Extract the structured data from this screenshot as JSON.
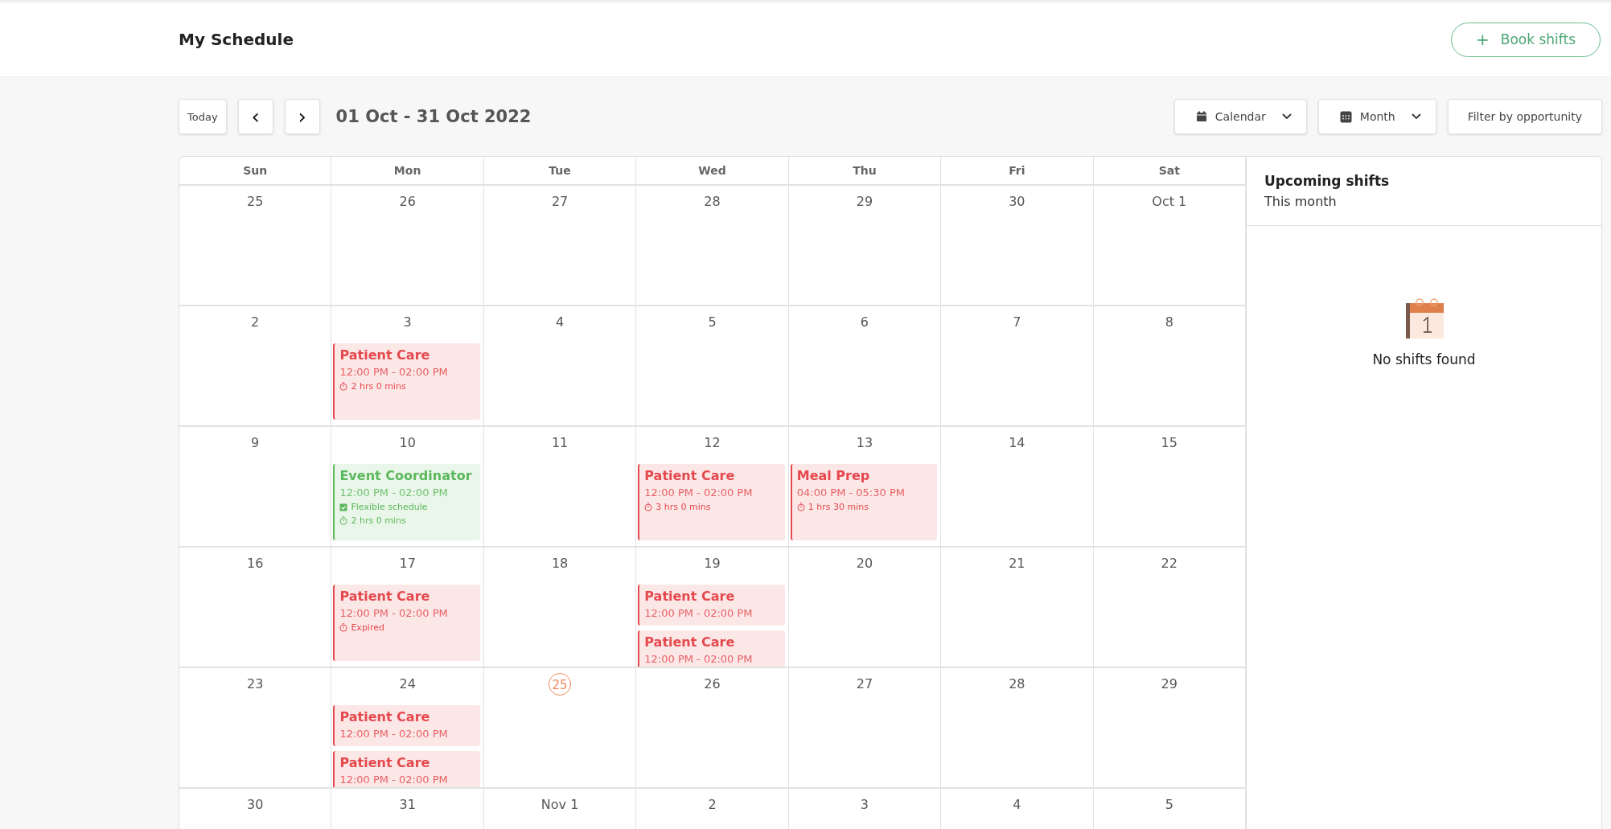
{
  "header": {
    "title": "My Schedule",
    "book_button": {
      "icon": "+",
      "label": "Book shifts"
    }
  },
  "toolbar": {
    "today": "Today",
    "prev": "‹",
    "next": "›",
    "range": "01 Oct - 31 Oct 2022",
    "view": "Calendar",
    "period": "Month",
    "filter": "Filter by opportunity"
  },
  "calendar": {
    "weekdays": [
      "Sun",
      "Mon",
      "Tue",
      "Wed",
      "Thu",
      "Fri",
      "Sat"
    ],
    "weeks": [
      {
        "days": [
          {
            "label": "25",
            "today": false
          },
          {
            "label": "26",
            "today": false
          },
          {
            "label": "27",
            "today": false
          },
          {
            "label": "28",
            "today": false
          },
          {
            "label": "29",
            "today": false
          },
          {
            "label": "30",
            "today": false
          },
          {
            "label": "Oct 1",
            "today": false
          }
        ]
      },
      {
        "days": [
          {
            "label": "2",
            "today": false
          },
          {
            "label": "3",
            "today": false,
            "events": [
              {
                "title": "Patient Care",
                "time": "12:00 PM - 02:00 PM",
                "color": "#e5484d",
                "details": [
                  {
                    "kind": "duration",
                    "text": "2 hrs 0 mins"
                  }
                ]
              }
            ]
          },
          {
            "label": "4",
            "today": false
          },
          {
            "label": "5",
            "today": false
          },
          {
            "label": "6",
            "today": false
          },
          {
            "label": "7",
            "today": false
          },
          {
            "label": "8",
            "today": false
          }
        ]
      },
      {
        "days": [
          {
            "label": "9",
            "today": false
          },
          {
            "label": "10",
            "today": false,
            "events": [
              {
                "title": "Event Coordinator",
                "time": "12:00 PM - 02:00 PM",
                "color": "#5cb85c",
                "details": [
                  {
                    "kind": "flexible",
                    "text": "Flexible schedule"
                  },
                  {
                    "kind": "duration",
                    "text": "2 hrs 0 mins"
                  }
                ]
              }
            ]
          },
          {
            "label": "11",
            "today": false
          },
          {
            "label": "12",
            "today": false,
            "events": [
              {
                "title": "Patient Care",
                "time": "12:00 PM - 02:00 PM",
                "color": "#e5484d",
                "details": [
                  {
                    "kind": "duration",
                    "text": "3 hrs 0 mins"
                  }
                ]
              }
            ]
          },
          {
            "label": "13",
            "today": false,
            "events": [
              {
                "title": "Meal Prep",
                "time": "04:00 PM - 05:30 PM",
                "color": "#e5484d",
                "details": [
                  {
                    "kind": "duration",
                    "text": "1 hrs 30 mins"
                  }
                ]
              }
            ]
          },
          {
            "label": "14",
            "today": false
          },
          {
            "label": "15",
            "today": false
          }
        ]
      },
      {
        "days": [
          {
            "label": "16",
            "today": false
          },
          {
            "label": "17",
            "today": false,
            "events": [
              {
                "title": "Patient Care",
                "time": "12:00 PM - 02:00 PM",
                "color": "#e5484d",
                "details": [
                  {
                    "kind": "duration",
                    "text": "Expired"
                  }
                ]
              }
            ]
          },
          {
            "label": "18",
            "today": false
          },
          {
            "label": "19",
            "today": false,
            "events": [
              {
                "title": "Patient Care",
                "time": "12:00 PM - 02:00 PM",
                "color": "#e5484d"
              },
              {
                "title": "Patient Care",
                "time": "12:00 PM - 02:00 PM",
                "color": "#e5484d"
              }
            ]
          },
          {
            "label": "20",
            "today": false
          },
          {
            "label": "21",
            "today": false
          },
          {
            "label": "22",
            "today": false
          }
        ]
      },
      {
        "days": [
          {
            "label": "23",
            "today": false
          },
          {
            "label": "24",
            "today": false,
            "events": [
              {
                "title": "Patient Care",
                "time": "12:00 PM - 02:00 PM",
                "color": "#e5484d"
              },
              {
                "title": "Patient Care",
                "time": "12:00 PM - 02:00 PM",
                "color": "#e5484d"
              }
            ]
          },
          {
            "label": "25",
            "today": true
          },
          {
            "label": "26",
            "today": false
          },
          {
            "label": "27",
            "today": false
          },
          {
            "label": "28",
            "today": false
          },
          {
            "label": "29",
            "today": false
          }
        ]
      },
      {
        "days": [
          {
            "label": "30",
            "today": false
          },
          {
            "label": "31",
            "today": false
          },
          {
            "label": "Nov 1",
            "today": false
          },
          {
            "label": "2",
            "today": false
          },
          {
            "label": "3",
            "today": false
          },
          {
            "label": "4",
            "today": false
          },
          {
            "label": "5",
            "today": false
          }
        ]
      }
    ]
  },
  "sidebar": {
    "title": "Upcoming shifts",
    "subtitle": "This month",
    "empty_text": "No shifts found"
  }
}
